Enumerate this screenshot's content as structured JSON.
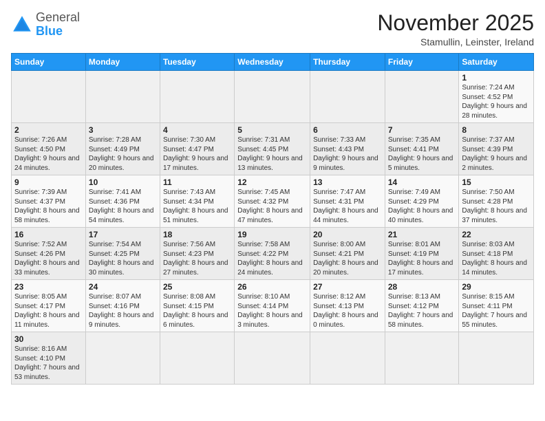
{
  "logo": {
    "general": "General",
    "blue": "Blue"
  },
  "title": "November 2025",
  "location": "Stamullin, Leinster, Ireland",
  "days_header": [
    "Sunday",
    "Monday",
    "Tuesday",
    "Wednesday",
    "Thursday",
    "Friday",
    "Saturday"
  ],
  "weeks": [
    [
      {
        "day": "",
        "info": ""
      },
      {
        "day": "",
        "info": ""
      },
      {
        "day": "",
        "info": ""
      },
      {
        "day": "",
        "info": ""
      },
      {
        "day": "",
        "info": ""
      },
      {
        "day": "",
        "info": ""
      },
      {
        "day": "1",
        "info": "Sunrise: 7:24 AM\nSunset: 4:52 PM\nDaylight: 9 hours and 28 minutes."
      }
    ],
    [
      {
        "day": "2",
        "info": "Sunrise: 7:26 AM\nSunset: 4:50 PM\nDaylight: 9 hours and 24 minutes."
      },
      {
        "day": "3",
        "info": "Sunrise: 7:28 AM\nSunset: 4:49 PM\nDaylight: 9 hours and 20 minutes."
      },
      {
        "day": "4",
        "info": "Sunrise: 7:30 AM\nSunset: 4:47 PM\nDaylight: 9 hours and 17 minutes."
      },
      {
        "day": "5",
        "info": "Sunrise: 7:31 AM\nSunset: 4:45 PM\nDaylight: 9 hours and 13 minutes."
      },
      {
        "day": "6",
        "info": "Sunrise: 7:33 AM\nSunset: 4:43 PM\nDaylight: 9 hours and 9 minutes."
      },
      {
        "day": "7",
        "info": "Sunrise: 7:35 AM\nSunset: 4:41 PM\nDaylight: 9 hours and 5 minutes."
      },
      {
        "day": "8",
        "info": "Sunrise: 7:37 AM\nSunset: 4:39 PM\nDaylight: 9 hours and 2 minutes."
      }
    ],
    [
      {
        "day": "9",
        "info": "Sunrise: 7:39 AM\nSunset: 4:37 PM\nDaylight: 8 hours and 58 minutes."
      },
      {
        "day": "10",
        "info": "Sunrise: 7:41 AM\nSunset: 4:36 PM\nDaylight: 8 hours and 54 minutes."
      },
      {
        "day": "11",
        "info": "Sunrise: 7:43 AM\nSunset: 4:34 PM\nDaylight: 8 hours and 51 minutes."
      },
      {
        "day": "12",
        "info": "Sunrise: 7:45 AM\nSunset: 4:32 PM\nDaylight: 8 hours and 47 minutes."
      },
      {
        "day": "13",
        "info": "Sunrise: 7:47 AM\nSunset: 4:31 PM\nDaylight: 8 hours and 44 minutes."
      },
      {
        "day": "14",
        "info": "Sunrise: 7:49 AM\nSunset: 4:29 PM\nDaylight: 8 hours and 40 minutes."
      },
      {
        "day": "15",
        "info": "Sunrise: 7:50 AM\nSunset: 4:28 PM\nDaylight: 8 hours and 37 minutes."
      }
    ],
    [
      {
        "day": "16",
        "info": "Sunrise: 7:52 AM\nSunset: 4:26 PM\nDaylight: 8 hours and 33 minutes."
      },
      {
        "day": "17",
        "info": "Sunrise: 7:54 AM\nSunset: 4:25 PM\nDaylight: 8 hours and 30 minutes."
      },
      {
        "day": "18",
        "info": "Sunrise: 7:56 AM\nSunset: 4:23 PM\nDaylight: 8 hours and 27 minutes."
      },
      {
        "day": "19",
        "info": "Sunrise: 7:58 AM\nSunset: 4:22 PM\nDaylight: 8 hours and 24 minutes."
      },
      {
        "day": "20",
        "info": "Sunrise: 8:00 AM\nSunset: 4:21 PM\nDaylight: 8 hours and 20 minutes."
      },
      {
        "day": "21",
        "info": "Sunrise: 8:01 AM\nSunset: 4:19 PM\nDaylight: 8 hours and 17 minutes."
      },
      {
        "day": "22",
        "info": "Sunrise: 8:03 AM\nSunset: 4:18 PM\nDaylight: 8 hours and 14 minutes."
      }
    ],
    [
      {
        "day": "23",
        "info": "Sunrise: 8:05 AM\nSunset: 4:17 PM\nDaylight: 8 hours and 11 minutes."
      },
      {
        "day": "24",
        "info": "Sunrise: 8:07 AM\nSunset: 4:16 PM\nDaylight: 8 hours and 9 minutes."
      },
      {
        "day": "25",
        "info": "Sunrise: 8:08 AM\nSunset: 4:15 PM\nDaylight: 8 hours and 6 minutes."
      },
      {
        "day": "26",
        "info": "Sunrise: 8:10 AM\nSunset: 4:14 PM\nDaylight: 8 hours and 3 minutes."
      },
      {
        "day": "27",
        "info": "Sunrise: 8:12 AM\nSunset: 4:13 PM\nDaylight: 8 hours and 0 minutes."
      },
      {
        "day": "28",
        "info": "Sunrise: 8:13 AM\nSunset: 4:12 PM\nDaylight: 7 hours and 58 minutes."
      },
      {
        "day": "29",
        "info": "Sunrise: 8:15 AM\nSunset: 4:11 PM\nDaylight: 7 hours and 55 minutes."
      }
    ],
    [
      {
        "day": "30",
        "info": "Sunrise: 8:16 AM\nSunset: 4:10 PM\nDaylight: 7 hours and 53 minutes."
      },
      {
        "day": "",
        "info": ""
      },
      {
        "day": "",
        "info": ""
      },
      {
        "day": "",
        "info": ""
      },
      {
        "day": "",
        "info": ""
      },
      {
        "day": "",
        "info": ""
      },
      {
        "day": "",
        "info": ""
      }
    ]
  ]
}
